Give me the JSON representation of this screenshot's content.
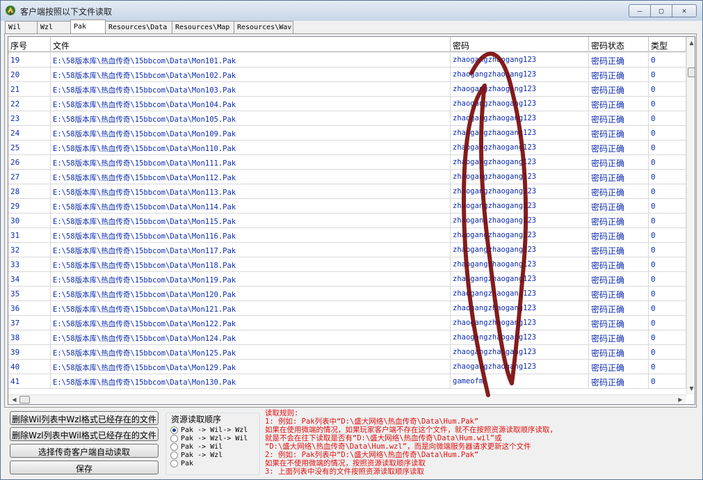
{
  "window": {
    "title": "客户端按照以下文件读取"
  },
  "window_buttons": {
    "minimize": "—",
    "maximize": "▢",
    "close": "✕"
  },
  "tabs": [
    "Wil",
    "Wzl",
    "Pak",
    "Resources\\Data",
    "Resources\\Map",
    "Resources\\Wav"
  ],
  "active_tab": "Pak",
  "table": {
    "columns": [
      "序号",
      "文件",
      "密码",
      "密码状态",
      "类型"
    ],
    "rows": [
      {
        "seq": "19",
        "file": "E:\\58版本库\\热血传奇\\15bbcom\\Data\\Mon101.Pak",
        "password": "zhaogangzhaogang123",
        "status": "密码正确",
        "type": "0"
      },
      {
        "seq": "20",
        "file": "E:\\58版本库\\热血传奇\\15bbcom\\Data\\Mon102.Pak",
        "password": "zhaogangzhaogang123",
        "status": "密码正确",
        "type": "0"
      },
      {
        "seq": "21",
        "file": "E:\\58版本库\\热血传奇\\15bbcom\\Data\\Mon103.Pak",
        "password": "zhaogangzhaogang123",
        "status": "密码正确",
        "type": "0"
      },
      {
        "seq": "22",
        "file": "E:\\58版本库\\热血传奇\\15bbcom\\Data\\Mon104.Pak",
        "password": "zhaogangzhaogang123",
        "status": "密码正确",
        "type": "0"
      },
      {
        "seq": "23",
        "file": "E:\\58版本库\\热血传奇\\15bbcom\\Data\\Mon105.Pak",
        "password": "zhaogangzhaogang123",
        "status": "密码正确",
        "type": "0"
      },
      {
        "seq": "24",
        "file": "E:\\58版本库\\热血传奇\\15bbcom\\Data\\Mon109.Pak",
        "password": "zhaogangzhaogang123",
        "status": "密码正确",
        "type": "0"
      },
      {
        "seq": "25",
        "file": "E:\\58版本库\\热血传奇\\15bbcom\\Data\\Mon110.Pak",
        "password": "zhaogangzhaogang123",
        "status": "密码正确",
        "type": "0"
      },
      {
        "seq": "26",
        "file": "E:\\58版本库\\热血传奇\\15bbcom\\Data\\Mon111.Pak",
        "password": "zhaogangzhaogang123",
        "status": "密码正确",
        "type": "0"
      },
      {
        "seq": "27",
        "file": "E:\\58版本库\\热血传奇\\15bbcom\\Data\\Mon112.Pak",
        "password": "zhaogangzhaogang123",
        "status": "密码正确",
        "type": "0"
      },
      {
        "seq": "28",
        "file": "E:\\58版本库\\热血传奇\\15bbcom\\Data\\Mon113.Pak",
        "password": "zhaogangzhaogang123",
        "status": "密码正确",
        "type": "0"
      },
      {
        "seq": "29",
        "file": "E:\\58版本库\\热血传奇\\15bbcom\\Data\\Mon114.Pak",
        "password": "zhaogangzhaogang123",
        "status": "密码正确",
        "type": "0"
      },
      {
        "seq": "30",
        "file": "E:\\58版本库\\热血传奇\\15bbcom\\Data\\Mon115.Pak",
        "password": "zhaogangzhaogang123",
        "status": "密码正确",
        "type": "0"
      },
      {
        "seq": "31",
        "file": "E:\\58版本库\\热血传奇\\15bbcom\\Data\\Mon116.Pak",
        "password": "zhaogangzhaogang123",
        "status": "密码正确",
        "type": "0"
      },
      {
        "seq": "32",
        "file": "E:\\58版本库\\热血传奇\\15bbcom\\Data\\Mon117.Pak",
        "password": "zhaogangzhaogang123",
        "status": "密码正确",
        "type": "0"
      },
      {
        "seq": "33",
        "file": "E:\\58版本库\\热血传奇\\15bbcom\\Data\\Mon118.Pak",
        "password": "zhaogangzhaogang123",
        "status": "密码正确",
        "type": "0"
      },
      {
        "seq": "34",
        "file": "E:\\58版本库\\热血传奇\\15bbcom\\Data\\Mon119.Pak",
        "password": "zhaogangzhaogang123",
        "status": "密码正确",
        "type": "0"
      },
      {
        "seq": "35",
        "file": "E:\\58版本库\\热血传奇\\15bbcom\\Data\\Mon120.Pak",
        "password": "zhaogangzhaogang123",
        "status": "密码正确",
        "type": "0"
      },
      {
        "seq": "36",
        "file": "E:\\58版本库\\热血传奇\\15bbcom\\Data\\Mon121.Pak",
        "password": "zhaogangzhaogang123",
        "status": "密码正确",
        "type": "0"
      },
      {
        "seq": "37",
        "file": "E:\\58版本库\\热血传奇\\15bbcom\\Data\\Mon122.Pak",
        "password": "zhaogangzhaogang123",
        "status": "密码正确",
        "type": "0"
      },
      {
        "seq": "38",
        "file": "E:\\58版本库\\热血传奇\\15bbcom\\Data\\Mon124.Pak",
        "password": "zhaogangzhaogang123",
        "status": "密码正确",
        "type": "0"
      },
      {
        "seq": "39",
        "file": "E:\\58版本库\\热血传奇\\15bbcom\\Data\\Mon125.Pak",
        "password": "zhaogangzhaogang123",
        "status": "密码正确",
        "type": "0"
      },
      {
        "seq": "40",
        "file": "E:\\58版本库\\热血传奇\\15bbcom\\Data\\Mon129.Pak",
        "password": "zhaogangzhaogang123",
        "status": "密码正确",
        "type": "0"
      },
      {
        "seq": "41",
        "file": "E:\\58版本库\\热血传奇\\15bbcom\\Data\\Mon130.Pak",
        "password": "gameofm",
        "status": "密码正确",
        "type": "0"
      }
    ]
  },
  "buttons": {
    "delete_wil": "删除Wil列表中Wzl格式已经存在的文件",
    "delete_wzl": "删除Wzl列表中Wil格式已经存在的文件",
    "auto_read": "选择传奇客户端自动读取",
    "save": "保存"
  },
  "read_order": {
    "title": "资源读取顺序",
    "options": [
      "Pak -> Wil-> Wzl",
      "Pak -> Wzl-> Wil",
      "Pak -> Wil",
      "Pak -> Wzl",
      "Pak"
    ],
    "selected": 0
  },
  "rules": [
    "读取规则:",
    "1: 例如: Pak列表中“D:\\盛大网络\\热血传奇\\Data\\Hum.Pak”",
    "    如果在使用微端的情况，如果玩家客户端不存在这个文件，就不在按照资源读取顺序读取，",
    "    就是不会在往下读取是否有“D:\\盛大网络\\热血传奇\\Data\\Hum.wil”或",
    "    “D:\\盛大网络\\热血传奇\\Data\\Hum.wzl”，而是向微端服务器请求更新这个文件",
    "2: 例如: Pak列表中“D:\\盛大网络\\热血传奇\\Data\\Hum.Pak”",
    "    如果在不使用微端的情况，按照资源读取顺序读取",
    "3: 上面列表中没有的文件按照资源读取顺序读取"
  ],
  "colors": {
    "table_text": "#0c2cb0",
    "rules_text": "#e01010",
    "ink_scribble": "#7a0a0a"
  }
}
